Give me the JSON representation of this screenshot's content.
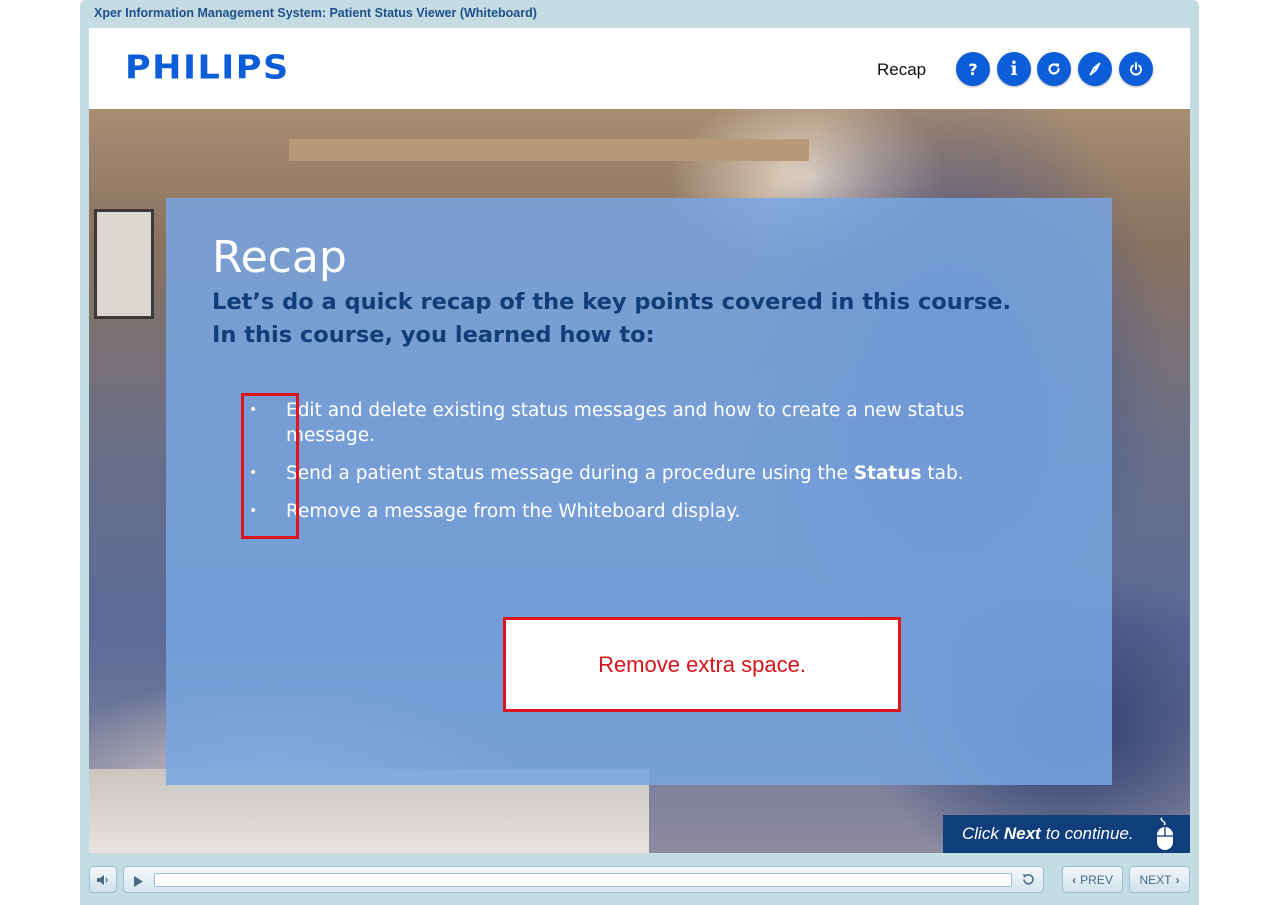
{
  "window": {
    "title": "Xper Information Management System: Patient Status Viewer (Whiteboard)"
  },
  "header": {
    "logo_text": "PHILIPS",
    "section_name": "Recap",
    "buttons": [
      {
        "name": "help",
        "label": "?",
        "icon": "question-icon"
      },
      {
        "name": "info",
        "label": "i",
        "icon": "info-icon"
      },
      {
        "name": "replay",
        "label": "",
        "icon": "replay-icon"
      },
      {
        "name": "navigate",
        "label": "",
        "icon": "compass-icon"
      },
      {
        "name": "exit",
        "label": "",
        "icon": "power-icon"
      }
    ]
  },
  "slide": {
    "title": "Recap",
    "intro_line1": "Let’s do a quick recap of the key points covered in this course.",
    "intro_line2": "In this course, you learned how to:",
    "bullets": [
      {
        "text": "Edit and delete existing status messages and how to create a new status message."
      },
      {
        "before": "Send a patient status message during a procedure using the ",
        "bold": "Status",
        "after": " tab."
      },
      {
        "text": "Remove a message from the Whiteboard display."
      }
    ],
    "bullet_glyph": "•"
  },
  "review_note": {
    "text": "Remove extra space."
  },
  "continue_prompt": {
    "before": "Click ",
    "bold": "Next",
    "after": " to continue."
  },
  "controls": {
    "prev_label": "PREV",
    "next_label": "NEXT",
    "progress": 0.0
  },
  "colors": {
    "brand_blue": "#0b5ed7",
    "dark_blue": "#103e7a",
    "annotation_red": "#e0141c",
    "panel_blue": "#78a5e2"
  }
}
